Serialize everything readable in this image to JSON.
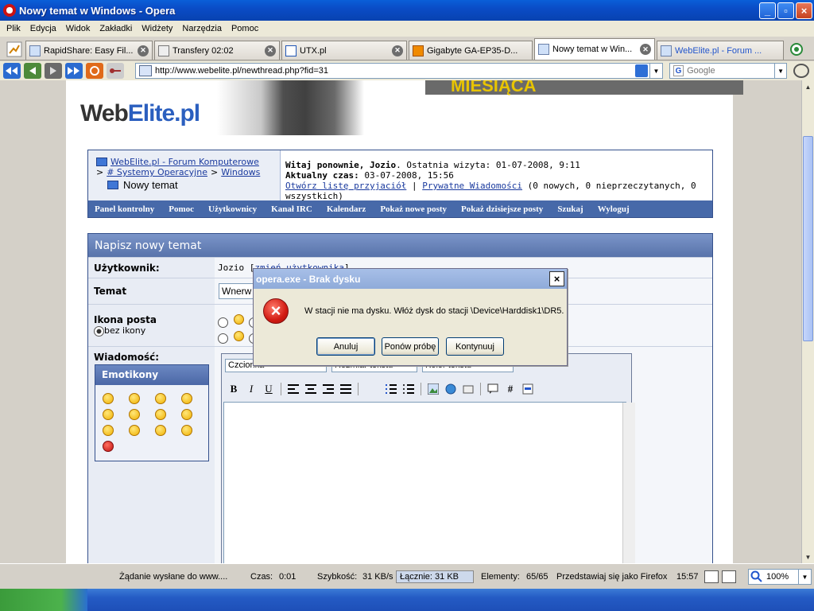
{
  "window": {
    "title": "Nowy temat w Windows - Opera",
    "minimize": "_",
    "maximize": "▫",
    "close": "×"
  },
  "menu": [
    "Plik",
    "Edycja",
    "Widok",
    "Zakładki",
    "Widżety",
    "Narzędzia",
    "Pomoc"
  ],
  "tabs": [
    {
      "label": "RapidShare: Easy Fil...",
      "active": false
    },
    {
      "label": "Transfery 02:02",
      "active": false
    },
    {
      "label": "UTX.pl",
      "active": false
    },
    {
      "label": "Gigabyte GA-EP35-D...",
      "active": false
    },
    {
      "label": "Nowy temat w Win...",
      "active": true
    },
    {
      "label": "WebElite.pl - Forum ...",
      "active": false
    }
  ],
  "address": {
    "url": "http://www.webelite.pl/newthread.php?fid=31",
    "search_placeholder": "Google"
  },
  "site": {
    "logo_part1": "Web",
    "logo_part2": "Elite.pl",
    "banner": "MIESIĄCA",
    "breadcrumb": {
      "forum": "WebElite.pl - Forum Komputerowe",
      "sep1": ">",
      "category": "# Systemy Operacyjne",
      "sep2": ">",
      "subforum": "Windows",
      "current": "Nowy temat"
    },
    "welcome_bold": "Witaj ponownie, Jozio",
    "welcome_rest": ". Ostatnia wizyta: 01-07-2008, 9:11",
    "time_bold": "Aktualny czas:",
    "time_rest": " 03-07-2008, 15:56",
    "friends_link": "Otwórz listę przyjaciół",
    "pm_sep": " | ",
    "pm_link": "Prywatne Wiadomości",
    "pm_counts": " (0 nowych, 0 nieprzeczytanych, 0 wszystkich)",
    "nav": [
      "Panel kontrolny",
      "Pomoc",
      "Użytkownicy",
      "Kanał IRC",
      "Kalendarz",
      "Pokaż nowe posty",
      "Pokaż dzisiejsze posty",
      "Szukaj",
      "Wyloguj"
    ]
  },
  "form": {
    "header": "Napisz nowy temat",
    "user_label": "Użytkownik:",
    "user_value": "Jozio [",
    "user_link": "zmień użytkownika",
    "user_close": "]",
    "subject_label": "Temat",
    "subject_value": "Wnerw",
    "icon_label": "Ikona posta",
    "icon_none": "bez ikony",
    "message_label": "Wiadomość:",
    "emoticons_title": "Emotikony",
    "font_select": "Czcionka",
    "size_select": "Rozmiar tekstu",
    "color_select": "Kolor tekstu",
    "bold": "B",
    "italic": "I",
    "underline": "U",
    "hash": "#"
  },
  "dialog": {
    "title": "opera.exe - Brak dysku",
    "close": "×",
    "icon": "×",
    "message": "W stacji nie ma dysku. Włóż dysk do stacji \\Device\\Harddisk1\\DR5.",
    "cancel": "Anuluj",
    "retry": "Ponów próbę",
    "continue": "Kontynuuj"
  },
  "status": {
    "request": "Żądanie wysłane do www....",
    "time_label": "Czas:",
    "time_value": "0:01",
    "speed_label": "Szybkość:",
    "speed_value": "31 KB/s",
    "total_label": "Łącznie:",
    "total_value": "31 KB",
    "elements_label": "Elementy:",
    "elements_value": "65/65",
    "identity": "Przedstawiaj się jako Firefox",
    "clock": "15:57",
    "zoom": "100%"
  }
}
